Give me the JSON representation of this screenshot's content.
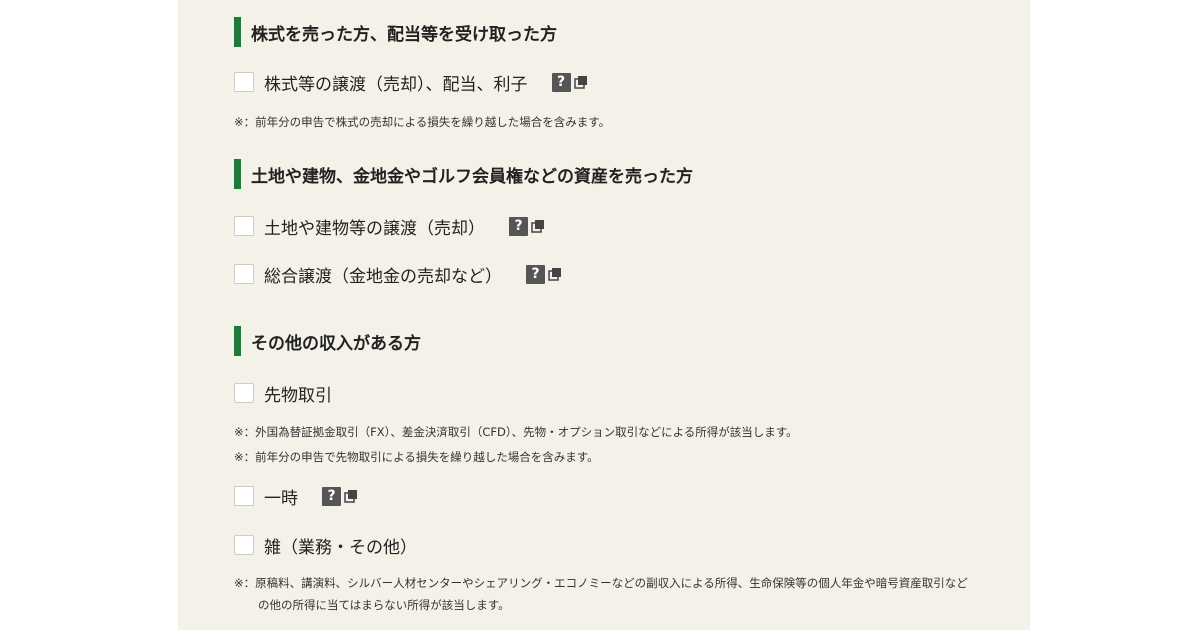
{
  "sections": [
    {
      "title": "株式を売った方、配当等を受け取った方",
      "items": [
        {
          "label": "株式等の譲渡（売却）、配当、利子",
          "help_icon": "?"
        }
      ],
      "notes": [
        "※：前年分の申告で株式の売却による損失を繰り越した場合を含みます。"
      ]
    },
    {
      "title": "土地や建物、金地金やゴルフ会員権などの資産を売った方",
      "items": [
        {
          "label": "土地や建物等の譲渡（売却）",
          "help_icon": "?"
        },
        {
          "label": "総合譲渡（金地金の売却など）",
          "help_icon": "?"
        }
      ]
    },
    {
      "title": "その他の収入がある方",
      "items": [
        {
          "label": "先物取引"
        },
        {
          "label": "一時",
          "help_icon": "?"
        },
        {
          "label": "雑（業務・その他）"
        }
      ],
      "notes": [
        "※：外国為替証拠金取引（FX）、差金決済取引（CFD）、先物・オプション取引などによる所得が該当します。",
        "※：前年分の申告で先物取引による損失を繰り越した場合を含みます。",
        "※：原稿料、講演料、シルバー人材センターやシェアリング・エコノミーなどの副収入による所得、生命保険等の個人年金や暗号資産取引などの他の所得に当てはまらない所得が該当します。"
      ]
    }
  ],
  "colors": {
    "accent_bar": "#1f7a3a",
    "panel_background": "#f4f1e9",
    "help_badge": "#555555"
  },
  "icons": {
    "help": "question-mark-icon",
    "external": "open-in-new-window-icon"
  }
}
